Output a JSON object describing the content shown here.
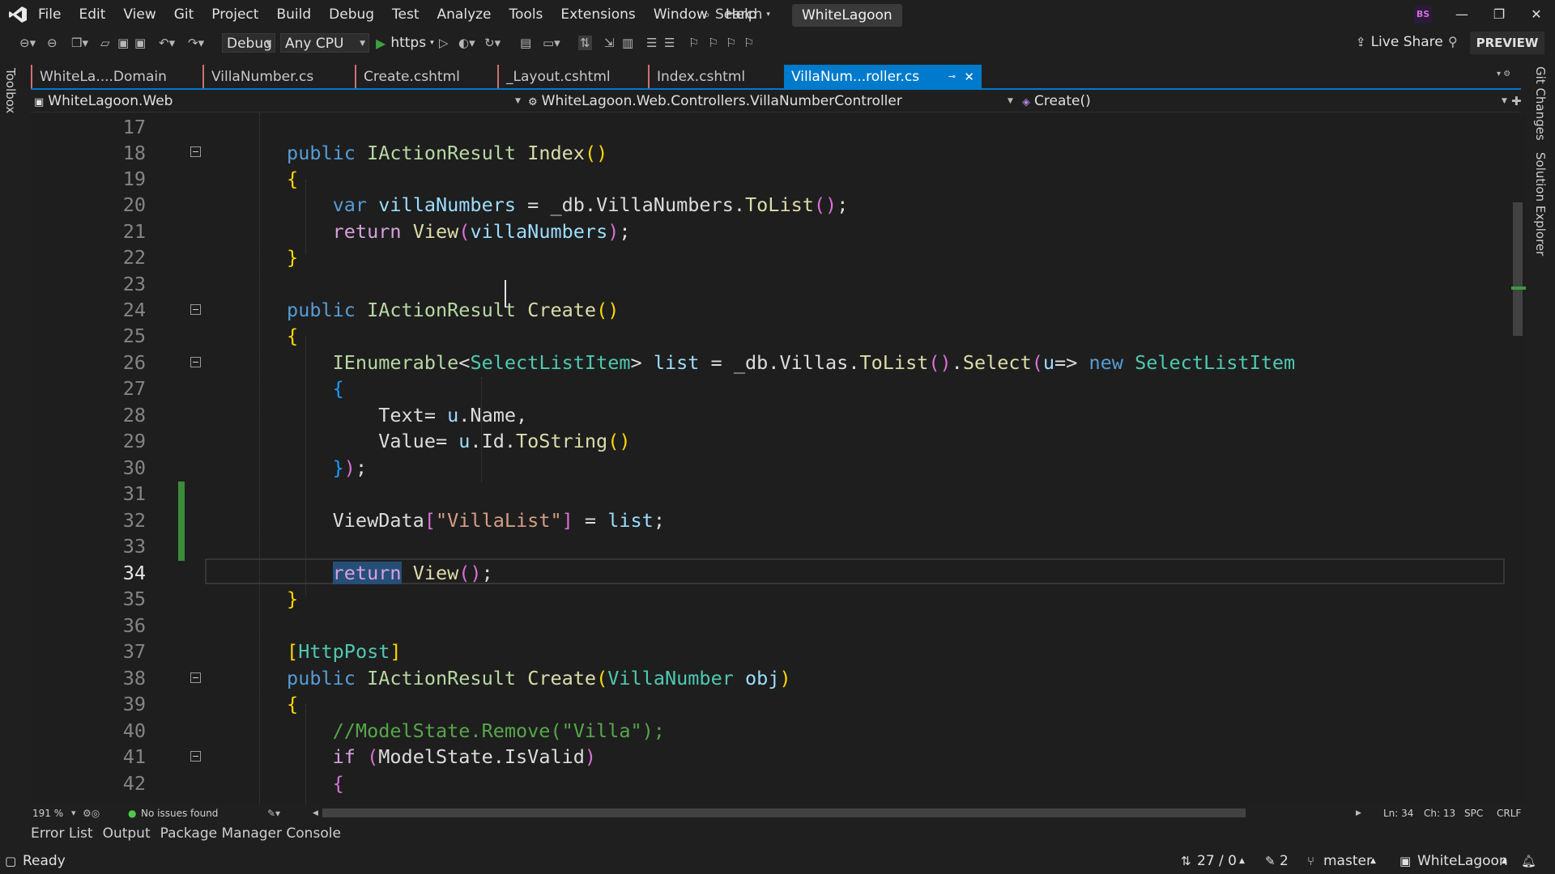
{
  "menu": {
    "items": [
      "File",
      "Edit",
      "View",
      "Git",
      "Project",
      "Build",
      "Debug",
      "Test",
      "Analyze",
      "Tools",
      "Extensions",
      "Window",
      "Help"
    ],
    "search_label": "Search",
    "solution_title": "WhiteLagoon",
    "user_initials": "BS"
  },
  "toolbar": {
    "config": "Debug",
    "platform": "Any CPU",
    "run_target": "https",
    "live_share": "Live Share",
    "preview": "PREVIEW"
  },
  "side_tabs": {
    "toolbox": "Toolbox",
    "git_changes": "Git Changes",
    "solution_explorer": "Solution Explorer"
  },
  "tabs": [
    {
      "label": "WhiteLa....Domain",
      "active": false
    },
    {
      "label": "VillaNumber.cs",
      "active": false
    },
    {
      "label": "Create.cshtml",
      "active": false
    },
    {
      "label": "_Layout.cshtml",
      "active": false
    },
    {
      "label": "Index.cshtml",
      "active": false
    },
    {
      "label": "VillaNum...roller.cs",
      "active": true
    }
  ],
  "navbar": {
    "project": "WhiteLagoon.Web",
    "type": "WhiteLagoon.Web.Controllers.VillaNumberController",
    "member": "Create()"
  },
  "code": {
    "line_numbers": [
      "17",
      "18",
      "19",
      "20",
      "21",
      "22",
      "23",
      "24",
      "25",
      "26",
      "27",
      "28",
      "29",
      "30",
      "31",
      "32",
      "33",
      "34",
      "35",
      "36",
      "37",
      "38",
      "39",
      "40",
      "41",
      "42"
    ],
    "current_line": "34"
  },
  "editor_status": {
    "zoom": "191 %",
    "issues": "No issues found",
    "line": "Ln: 34",
    "char": "Ch: 13",
    "spacing": "SPC",
    "line_ending": "CRLF"
  },
  "bottom_tabs": [
    "Error List",
    "Output",
    "Package Manager Console"
  ],
  "statusbar": {
    "ready": "Ready",
    "commits": "27 / 0",
    "changes": "2",
    "branch": "master",
    "repo": "WhiteLagoon"
  },
  "colors": {
    "accent": "#007acc",
    "keyword": "#569cd6",
    "type": "#4ec9b0",
    "method": "#dcdcaa",
    "string": "#d69d85",
    "comment": "#57a64a",
    "change_bar": "#3a8c3a"
  }
}
